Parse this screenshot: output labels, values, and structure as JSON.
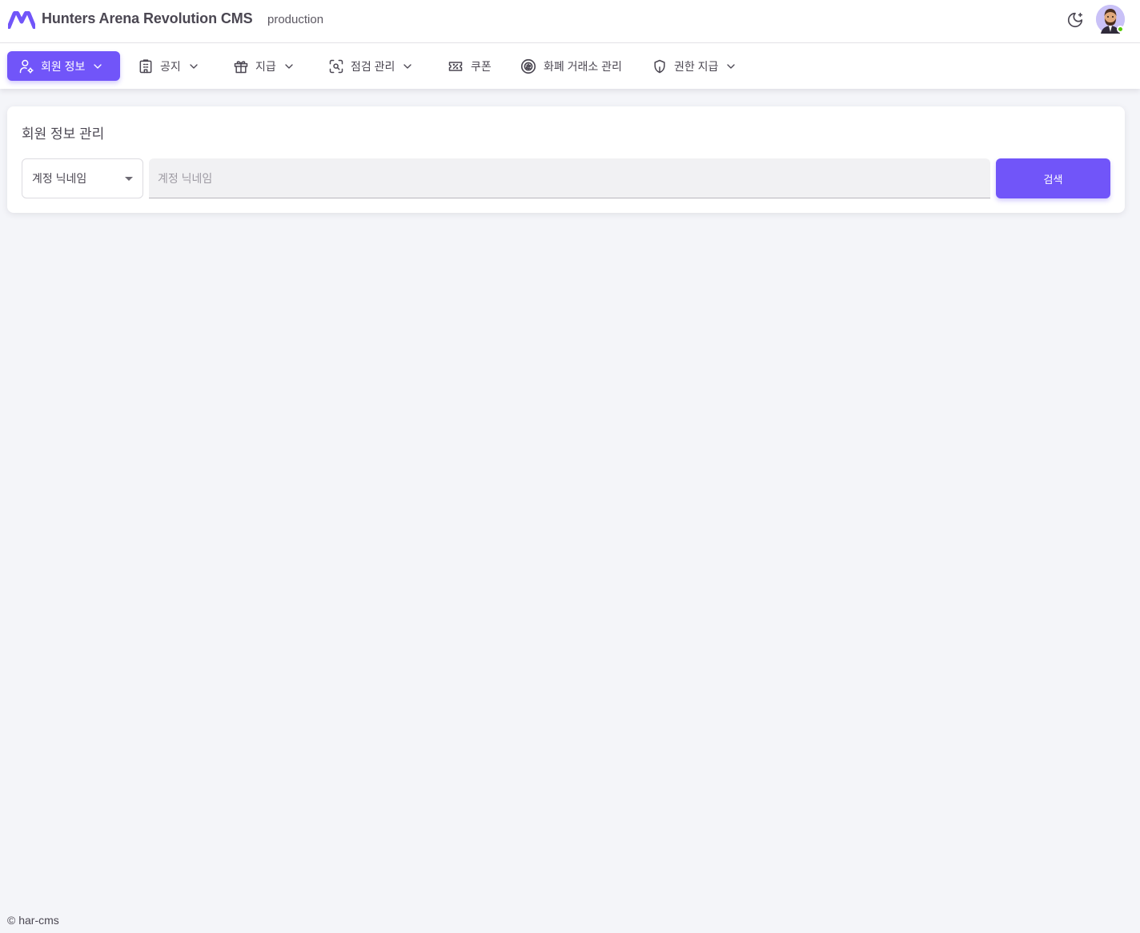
{
  "header": {
    "brand": "Hunters Arena Revolution CMS",
    "environment": "production",
    "logo_icon": "m-logo-icon",
    "theme_icon": "moon-star-icon",
    "avatar_status_color": "#56ca00"
  },
  "nav": {
    "items": [
      {
        "label": "회원 정보",
        "icon": "user-cog-icon",
        "dropdown": true,
        "active": true
      },
      {
        "label": "공지",
        "icon": "building-icon",
        "dropdown": true
      },
      {
        "label": "지급",
        "icon": "gift-icon",
        "dropdown": true
      },
      {
        "label": "점검 관리",
        "icon": "scan-search-icon",
        "dropdown": true
      },
      {
        "label": "쿠폰",
        "icon": "ticket-percent-icon",
        "dropdown": false
      },
      {
        "label": "화폐 거래소 관리",
        "icon": "currency-exchange-icon",
        "dropdown": false
      },
      {
        "label": "권한 지급",
        "icon": "shield-icon",
        "dropdown": true
      }
    ]
  },
  "card": {
    "title": "회원 정보 관리",
    "select_value": "계정 닉네임",
    "search_placeholder": "계정 닉네임",
    "search_value": "",
    "search_button": "검색"
  },
  "footer": {
    "text": "© har-cms"
  },
  "colors": {
    "primary": "#7155f9",
    "background": "#f4f5f9"
  }
}
